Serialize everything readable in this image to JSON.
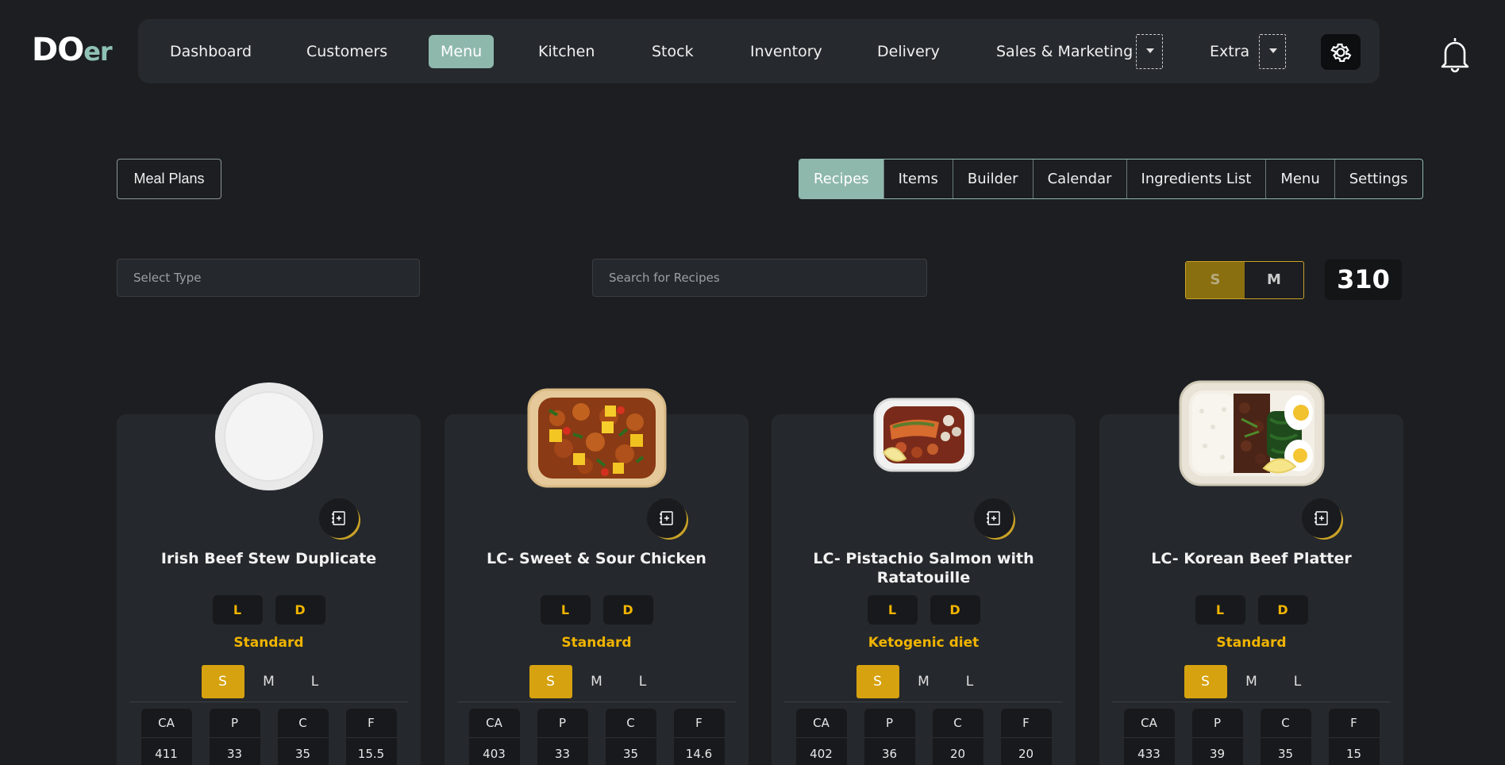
{
  "brand": {
    "part1": "DO",
    "part2": "er"
  },
  "nav": {
    "items": [
      "Dashboard",
      "Customers",
      "Menu",
      "Kitchen",
      "Stock",
      "Inventory",
      "Delivery",
      "Sales & Marketing",
      "Extra"
    ],
    "active": "Menu"
  },
  "subnav": {
    "meal_plans": "Meal Plans",
    "tabs": [
      "Recipes",
      "Items",
      "Builder",
      "Calendar",
      "Ingredients List",
      "Menu",
      "Settings"
    ],
    "active_tab": "Recipes"
  },
  "filters": {
    "type_placeholder": "Select Type",
    "search_placeholder": "Search for Recipes",
    "size_options": [
      "S",
      "M"
    ],
    "selected_size": "S",
    "count": "310"
  },
  "cards": [
    {
      "title": "Irish Beef Stew Duplicate",
      "tags": [
        "L",
        "D"
      ],
      "diet": "Standard",
      "sizes": [
        "S",
        "M",
        "L"
      ],
      "selected_size": "S",
      "macros": [
        {
          "label": "CA",
          "value": "411"
        },
        {
          "label": "P",
          "value": "33"
        },
        {
          "label": "C",
          "value": "35"
        },
        {
          "label": "F",
          "value": "15.5"
        }
      ]
    },
    {
      "title": "LC- Sweet & Sour Chicken",
      "tags": [
        "L",
        "D"
      ],
      "diet": "Standard",
      "sizes": [
        "S",
        "M",
        "L"
      ],
      "selected_size": "S",
      "macros": [
        {
          "label": "CA",
          "value": "403"
        },
        {
          "label": "P",
          "value": "33"
        },
        {
          "label": "C",
          "value": "35"
        },
        {
          "label": "F",
          "value": "14.6"
        }
      ]
    },
    {
      "title": "LC- Pistachio Salmon with Ratatouille",
      "tags": [
        "L",
        "D"
      ],
      "diet": "Ketogenic diet",
      "sizes": [
        "S",
        "M",
        "L"
      ],
      "selected_size": "S",
      "macros": [
        {
          "label": "CA",
          "value": "402"
        },
        {
          "label": "P",
          "value": "36"
        },
        {
          "label": "C",
          "value": "20"
        },
        {
          "label": "F",
          "value": "20"
        }
      ]
    },
    {
      "title": "LC- Korean Beef Platter",
      "tags": [
        "L",
        "D"
      ],
      "diet": "Standard",
      "sizes": [
        "S",
        "M",
        "L"
      ],
      "selected_size": "S",
      "macros": [
        {
          "label": "CA",
          "value": "433"
        },
        {
          "label": "P",
          "value": "39"
        },
        {
          "label": "C",
          "value": "35"
        },
        {
          "label": "F",
          "value": "15"
        }
      ]
    }
  ],
  "colors": {
    "background": "#1c1e21",
    "panel": "#25282c",
    "accent_teal": "#8fb8ad",
    "accent_gold": "#f0b400"
  },
  "icons": [
    "settings-gear-icon",
    "notification-bell-icon",
    "add-to-plan-icon",
    "chevron-down-icon"
  ]
}
